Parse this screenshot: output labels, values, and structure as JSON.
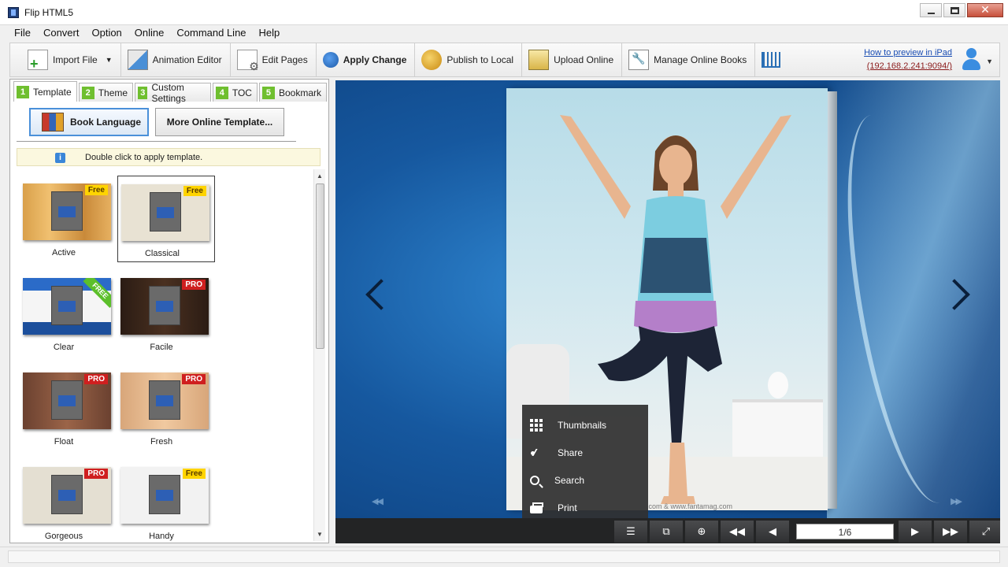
{
  "window": {
    "title": "Flip HTML5"
  },
  "menu": [
    "File",
    "Convert",
    "Option",
    "Online",
    "Command Line",
    "Help"
  ],
  "toolbar": {
    "import_file": "Import File",
    "animation_editor": "Animation Editor",
    "edit_pages": "Edit Pages",
    "apply_change": "Apply Change",
    "publish_local": "Publish to Local",
    "upload_online": "Upload Online",
    "manage_online": "Manage Online Books",
    "preview_link": "How to preview in iPad",
    "preview_ip": "(192.168.2.241:9094/)"
  },
  "tabs": [
    {
      "num": "1",
      "label": "Template"
    },
    {
      "num": "2",
      "label": "Theme"
    },
    {
      "num": "3",
      "label": "Custom Settings"
    },
    {
      "num": "4",
      "label": "TOC"
    },
    {
      "num": "5",
      "label": "Bookmark"
    }
  ],
  "panel": {
    "book_language": "Book Language",
    "more_templates": "More Online Template...",
    "hint": "Double click to apply template."
  },
  "templates": [
    {
      "name": "Active",
      "badge": "Free"
    },
    {
      "name": "Classical",
      "badge": "Free"
    },
    {
      "name": "Clear",
      "badge": "FREE"
    },
    {
      "name": "Facile",
      "badge": "PRO"
    },
    {
      "name": "Float",
      "badge": "PRO"
    },
    {
      "name": "Fresh",
      "badge": "PRO"
    },
    {
      "name": "Gorgeous",
      "badge": "PRO"
    },
    {
      "name": "Handy",
      "badge": "Free"
    }
  ],
  "preview": {
    "credit": ".com & www.fantamag.com",
    "menu": [
      "Thumbnails",
      "Share",
      "Search",
      "Print"
    ],
    "page_indicator": "1/6"
  },
  "colors": {
    "tab_number": "#6fbf2f",
    "link": "#1a4db3",
    "badge_free": "#ffd400",
    "badge_pro": "#cf1f1f"
  }
}
